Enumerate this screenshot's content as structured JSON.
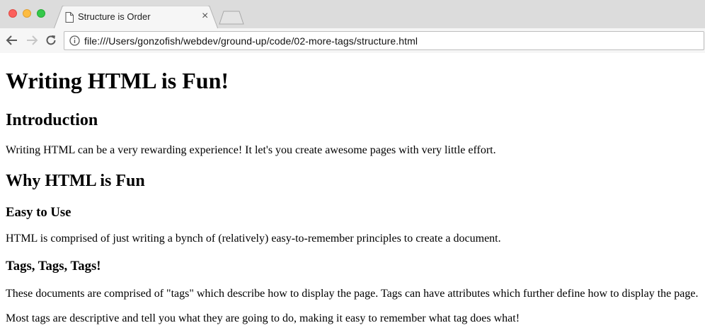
{
  "browser": {
    "tab": {
      "title": "Structure is Order",
      "close_glyph": "×",
      "icon": "page-icon"
    },
    "address_bar": {
      "url": "file:///Users/gonzofish/webdev/ground-up/code/02-more-tags/structure.html",
      "icon": "info-icon"
    },
    "nav_icons": [
      "back-arrow-icon",
      "forward-arrow-icon",
      "reload-icon"
    ]
  },
  "page": {
    "h1": "Writing HTML is Fun!",
    "intro_heading": "Introduction",
    "intro_paragraph": "Writing HTML can be a very rewarding experience! It let's you create awesome pages with very little effort.",
    "why_heading": "Why HTML is Fun",
    "easy_heading": "Easy to Use",
    "easy_paragraph": "HTML is comprised of just writing a bynch of (relatively) easy-to-remember principles to create a document.",
    "tags_heading": "Tags, Tags, Tags!",
    "tags_paragraph_1": "These documents are comprised of \"tags\" which describe how to display the page. Tags can have attributes which further define how to display the page.",
    "tags_paragraph_2": "Most tags are descriptive and tell you what they are going to do, making it easy to remember what tag does what!"
  },
  "colors": {
    "close": "#fc605c",
    "minimize": "#fdbc40",
    "zoom": "#34c84a",
    "chrome_bg": "#dcdcdc",
    "toolbar_bg": "#f6f6f6"
  }
}
